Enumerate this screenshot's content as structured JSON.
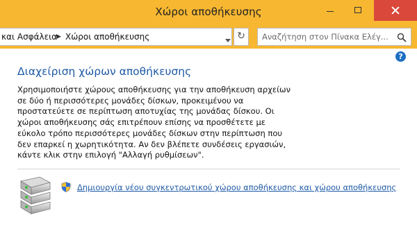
{
  "window": {
    "title": "Χώροι αποθήκευσης",
    "controls": [
      "minimize",
      "maximize",
      "close"
    ]
  },
  "address_bar": {
    "breadcrumbs": [
      "και Ασφάλεια",
      "Χώροι αποθήκευσης"
    ],
    "search_placeholder": "Αναζήτηση στον Πίνακα Ελέγ..."
  },
  "main": {
    "heading": "Διαχείριση χώρων αποθήκευσης",
    "description": "Χρησιμοποιήστε χώρους αποθήκευσης για την αποθήκευση αρχείων σε δύο ή περισσότερες μονάδες δίσκων, προκειμένου να προστατεύετε σε περίπτωση αποτυχίας της μονάδας δίσκου. Οι χώροι αποθήκευσης σάς επιτρέπουν επίσης να προσθέτετε με εύκολο τρόπο περισσότερες μονάδες δίσκων στην περίπτωση που δεν επαρκεί η χωρητικότητα. Αν δεν βλέπετε συνδέσεις εργασιών, κάντε κλικ στην επιλογή \"Αλλαγή ρυθμίσεων\".",
    "create_link": "Δημιουργία νέου συγκεντρωτικού χώρου αποθήκευσης και χώρου αποθήκευσης"
  },
  "icons": {
    "help": "help-icon",
    "drives": "storage-drives-icon",
    "shield": "uac-shield-icon",
    "refresh": "refresh-icon",
    "search": "search-icon"
  },
  "colors": {
    "titlebar": "#f7b731",
    "close_button": "#d9483b",
    "heading": "#1e5aa5",
    "link": "#1e5aa5"
  }
}
